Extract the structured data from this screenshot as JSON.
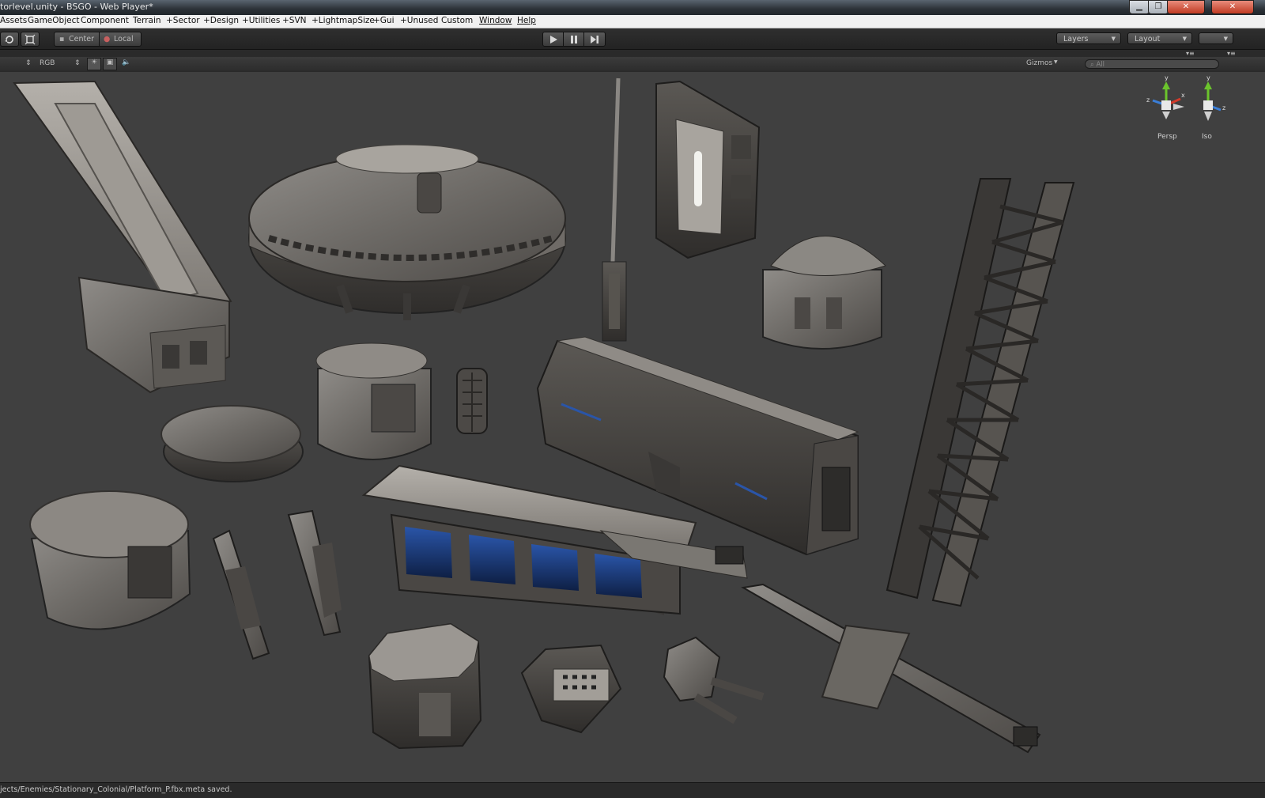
{
  "window": {
    "title": "torlevel.unity - BSGO - Web Player*",
    "minimize": "▁",
    "restore": "❐",
    "close": "✕"
  },
  "menu": {
    "items": [
      "Assets",
      "GameObject",
      "Component",
      "Terrain",
      "+Sector",
      "+Design",
      "+Utilities",
      "+SVN",
      "+LightmapSize",
      "+Gui",
      "+Unused",
      "Custom",
      "Window",
      "Help"
    ]
  },
  "toolbar": {
    "pivot_label": "Center",
    "space_label": "Local",
    "layers_label": "Layers",
    "layout_label": "Layout"
  },
  "scene_toolbar": {
    "render_mode": "RGB",
    "gizmos_label": "Gizmos",
    "search_placeholder": "All"
  },
  "gizmos": {
    "persp_label": "Persp",
    "iso_label": "Iso",
    "axis_x": "x",
    "axis_y": "y",
    "axis_z": "z"
  },
  "status": {
    "message": "jects/Enemies/Stationary_Colonial/Platform_P.fbx.meta saved."
  },
  "colors": {
    "viewport_bg": "#404040",
    "axis_x": "#d43a2a",
    "axis_y": "#6bc42c",
    "axis_z": "#3a7ed8"
  }
}
